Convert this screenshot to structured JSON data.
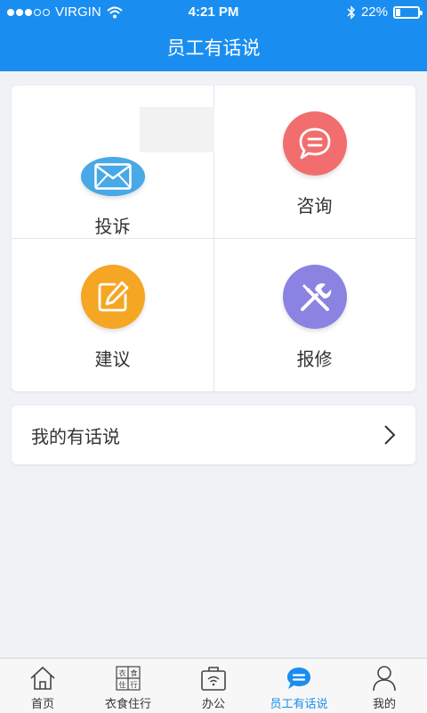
{
  "status_bar": {
    "carrier": "VIRGIN",
    "time": "4:21 PM",
    "battery": "22%",
    "battery_level": 0.22
  },
  "header": {
    "title": "员工有话说"
  },
  "grid": {
    "items": [
      {
        "label": "投诉",
        "icon": "mail-icon",
        "color": "#49a8e6"
      },
      {
        "label": "咨询",
        "icon": "chat-bubble-icon",
        "color": "#f26e6e"
      },
      {
        "label": "建议",
        "icon": "edit-icon",
        "color": "#f5a623"
      },
      {
        "label": "报修",
        "icon": "tools-icon",
        "color": "#8b83e2"
      }
    ]
  },
  "my_feedback": {
    "label": "我的有话说"
  },
  "tabbar": {
    "tabs": [
      {
        "label": "首页",
        "icon": "home-icon",
        "active": false
      },
      {
        "label": "衣食住行",
        "icon": "grid-icon",
        "active": false,
        "icon_chars": [
          "衣",
          "食",
          "住",
          "行"
        ]
      },
      {
        "label": "办公",
        "icon": "briefcase-wifi-icon",
        "active": false
      },
      {
        "label": "员工有话说",
        "icon": "chat-bubble-icon",
        "active": true
      },
      {
        "label": "我的",
        "icon": "person-icon",
        "active": false
      }
    ]
  },
  "colors": {
    "primary": "#1a8ef0",
    "background": "#f0f2f6"
  }
}
